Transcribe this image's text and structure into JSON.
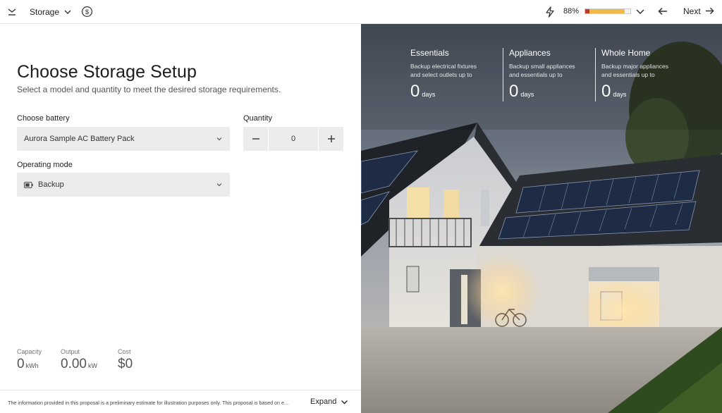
{
  "topbar": {
    "page_label": "Storage",
    "battery_percent": "88%",
    "battery_fill_fraction": 0.88,
    "next_label": "Next"
  },
  "main": {
    "title": "Choose Storage Setup",
    "subtitle": "Select a model and quantity to meet the desired storage requirements.",
    "battery_label": "Choose battery",
    "battery_value": "Aurora Sample AC Battery Pack",
    "quantity_label": "Quantity",
    "quantity_value": "0",
    "mode_label": "Operating mode",
    "mode_value": "Backup"
  },
  "stats": {
    "capacity_label": "Capacity",
    "capacity_value": "0",
    "capacity_unit": "kWh",
    "output_label": "Output",
    "output_value": "0.00",
    "output_unit": "kW",
    "cost_label": "Cost",
    "cost_value": "$0"
  },
  "footer": {
    "disclaimer": "The information provided in this proposal is a preliminary estimate for illustration purposes only. This proposal is based on e...",
    "expand_label": "Expand"
  },
  "backup": {
    "columns": [
      {
        "title": "Essentials",
        "desc1": "Backup electrical fixtures",
        "desc2": "and select outlets up to",
        "value": "0",
        "unit": "days"
      },
      {
        "title": "Appliances",
        "desc1": "Backup small appliances",
        "desc2": "and essentials up to",
        "value": "0",
        "unit": "days"
      },
      {
        "title": "Whole Home",
        "desc1": "Backup major appliances",
        "desc2": "and essentials up to",
        "value": "0",
        "unit": "days"
      }
    ]
  },
  "colors": {
    "accent_bar": "#f0b94a",
    "accent_bar_cap": "#c0392b",
    "field_bg": "#ececec"
  },
  "icons": {
    "collapse": "chevron-collapse-icon",
    "page_chevron": "chevron-down-icon",
    "pricing": "dollar-circle-icon",
    "energy": "lightning-bolt-icon",
    "back": "arrow-left-icon",
    "next": "arrow-right-icon",
    "battery_mode": "battery-icon"
  }
}
